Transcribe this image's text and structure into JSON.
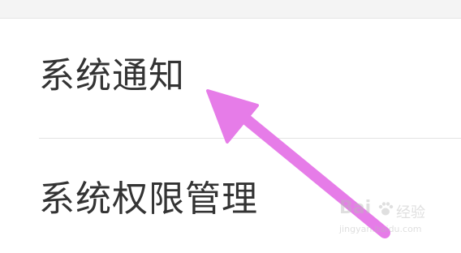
{
  "settings_list": {
    "items": [
      {
        "label": "系统通知"
      },
      {
        "label": "系统权限管理"
      }
    ]
  },
  "annotation": {
    "arrow_color": "#e67ce8",
    "icon": "arrow-pointer-icon"
  },
  "watermark": {
    "logo": "Bai",
    "sub": "经验",
    "url": "jingyan.baidu.com"
  }
}
